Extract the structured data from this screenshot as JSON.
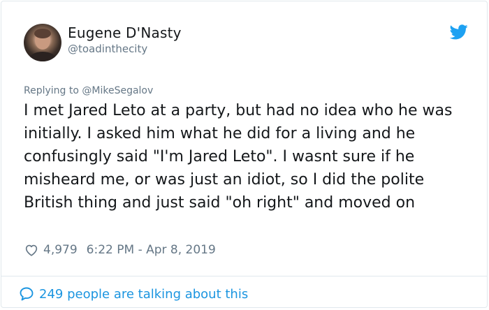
{
  "author": {
    "display_name": "Eugene D'Nasty",
    "handle": "@toadinthecity"
  },
  "reply_to": "Replying to @MikeSegalov",
  "tweet": {
    "text": "I met Jared Leto at a party, but had no idea who he was initially. I asked him what he did for a living and he confusingly said \"I'm Jared Leto\". I wasnt sure if he misheard me, or was just an idiot, so I did the polite British thing and just said \"oh right\" and moved on"
  },
  "meta": {
    "likes": "4,979",
    "timestamp": "6:22 PM - Apr 8, 2019"
  },
  "footer": {
    "talking": "249 people are talking about this"
  },
  "icons": {
    "brand": "twitter-bird-icon",
    "like": "heart-icon",
    "conversation": "speech-bubble-icon"
  },
  "colors": {
    "brand_blue": "#1da1f2",
    "link_blue": "#1b95e0",
    "secondary_text": "#657786",
    "border": "#e1e8ed"
  }
}
